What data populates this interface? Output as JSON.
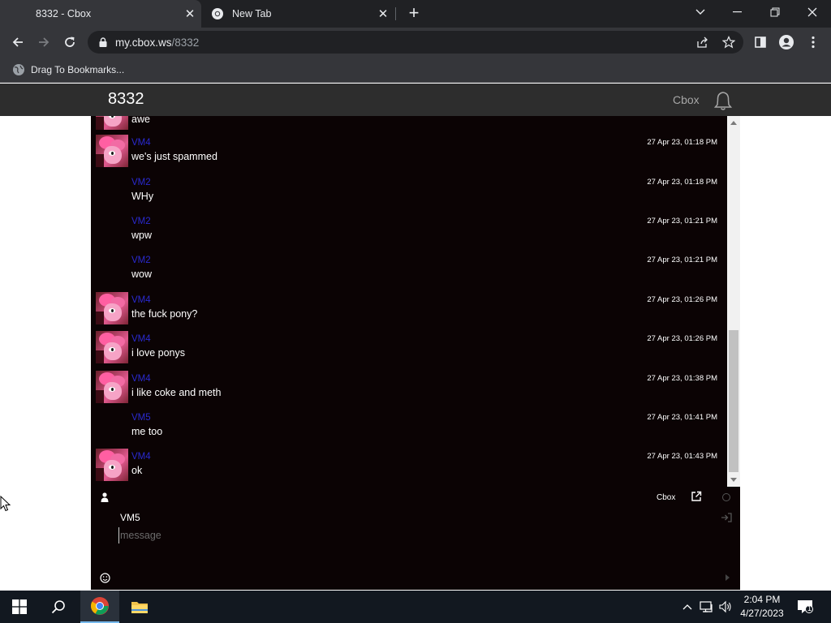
{
  "browser": {
    "tabs": [
      {
        "title": "8332 - Cbox"
      },
      {
        "title": "New Tab"
      }
    ],
    "url_host": "my.cbox.ws",
    "url_path": "/8332",
    "bookmarks_bar": {
      "label": "Drag To Bookmarks..."
    }
  },
  "site": {
    "title": "8332",
    "brand": "Cbox"
  },
  "messages": [
    {
      "user": "",
      "text": "awe",
      "time": "",
      "avatar": true
    },
    {
      "user": "VM4",
      "text": "we's just spammed",
      "time": "27 Apr 23, 01:18 PM",
      "avatar": true
    },
    {
      "user": "VM2",
      "text": "WHy",
      "time": "27 Apr 23, 01:18 PM",
      "avatar": false
    },
    {
      "user": "VM2",
      "text": "wpw",
      "time": "27 Apr 23, 01:21 PM",
      "avatar": false
    },
    {
      "user": "VM2",
      "text": "wow",
      "time": "27 Apr 23, 01:21 PM",
      "avatar": false
    },
    {
      "user": "VM4",
      "text": "the fuck pony?",
      "time": "27 Apr 23, 01:26 PM",
      "avatar": true
    },
    {
      "user": "VM4",
      "text": "i love ponys",
      "time": "27 Apr 23, 01:26 PM",
      "avatar": true
    },
    {
      "user": "VM4",
      "text": "i like coke and meth",
      "time": "27 Apr 23, 01:38 PM",
      "avatar": true
    },
    {
      "user": "VM5",
      "text": "me too",
      "time": "27 Apr 23, 01:41 PM",
      "avatar": false
    },
    {
      "user": "VM4",
      "text": "ok",
      "time": "27 Apr 23, 01:43 PM",
      "avatar": true
    }
  ],
  "chat_footer": {
    "brand": "Cbox"
  },
  "compose": {
    "name": "VM5",
    "placeholder": "message"
  },
  "taskbar": {
    "time": "2:04 PM",
    "date": "4/27/2023",
    "notification_count": "1"
  },
  "colors": {
    "chat_bg": "#0b0304",
    "username": "#2a2ad0",
    "header_bg": "#2d2d2d"
  }
}
